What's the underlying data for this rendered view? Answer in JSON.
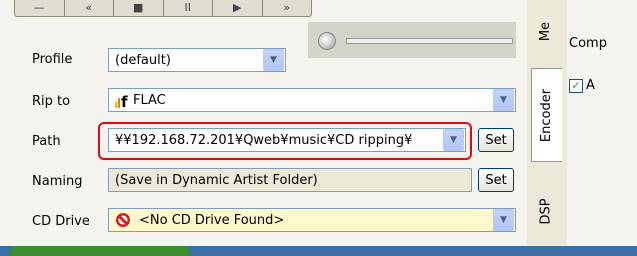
{
  "toolbar": {
    "buttons": [
      "—",
      "«",
      "■",
      "II",
      "▶",
      "»"
    ]
  },
  "rows": {
    "profile": {
      "label": "Profile",
      "value": "(default)"
    },
    "rip_to": {
      "label": "Rip to",
      "value": "FLAC",
      "icon": "flac-icon"
    },
    "path": {
      "label": "Path",
      "value": "¥¥192.168.72.201¥Qweb¥music¥CD ripping¥",
      "set_label": "Set"
    },
    "naming": {
      "label": "Naming",
      "value": "(Save in Dynamic Artist Folder)",
      "set_label": "Set"
    },
    "cd_drive": {
      "label": "CD Drive",
      "value": "<No CD Drive Found>",
      "icon": "no-entry-icon"
    }
  },
  "tabs": [
    {
      "label": "Me"
    },
    {
      "label": "Encoder"
    },
    {
      "label": "DSP"
    }
  ],
  "right": {
    "text1": "Comp",
    "checkbox_label": "A",
    "checked": true
  },
  "colors": {
    "highlight": "#e00a14",
    "cd_drive_bg": "#fff8cc",
    "accent": "#316ac5"
  }
}
